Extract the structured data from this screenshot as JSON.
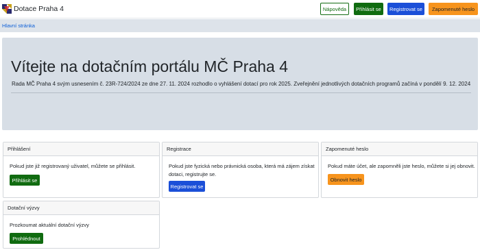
{
  "header": {
    "brand": "Dotace Praha 4",
    "help_label": "Nápověda",
    "login_label": "Přihlásit se",
    "register_label": "Registrovat se",
    "forgot_label": "Zapomenuté heslo"
  },
  "breadcrumb": {
    "home": "Hlavní stránka"
  },
  "hero": {
    "title": "Vítejte na dotačním portálu MČ Praha 4",
    "text": "Rada MČ Praha 4 svým usnesením č. 23R-724/2024 ze dne 27. 11. 2024 rozhodlo o vyhlášení dotací pro rok 2025. Zveřejnění jednotlivých dotačních programů začíná v pondělí 9. 12. 2024"
  },
  "cards": {
    "login": {
      "title": "Přihlášení",
      "text": "Pokud jste již registrovaný uživatel, můžete se přihlásit.",
      "button": "Přihlásit se"
    },
    "register": {
      "title": "Registrace",
      "text1": "Pokud jste fyzická nebo právnická osoba, která má zájem získat",
      "text2": "dotaci, registrujte se.",
      "button": "Registrovat se"
    },
    "forgot": {
      "title": "Zapomenuté heslo",
      "text": "Pokud máte účet, ale zapomněli jste heslo, můžete si jej obnovit.",
      "button": "Obnovit heslo"
    },
    "calls": {
      "title": "Dotační výzvy",
      "text": "Prozkoumat aktuální dotační výzvy",
      "button": "Prohlédnout"
    }
  },
  "colors": {
    "green": "#106b10",
    "blue": "#1b4fd8",
    "orange": "#f7941d",
    "hero_bg": "#d7dee6"
  },
  "icons": {
    "logo": "praha4-logo-icon"
  }
}
